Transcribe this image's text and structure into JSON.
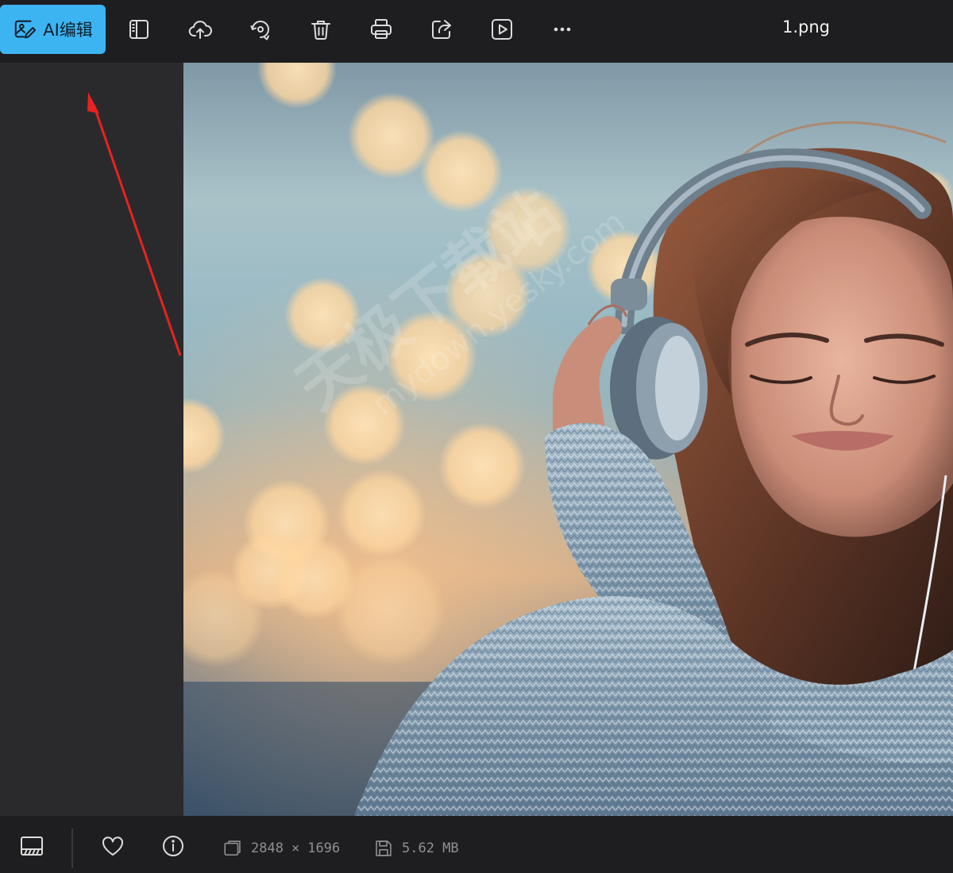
{
  "toolbar": {
    "ai_edit_label": "AI编辑",
    "tools": [
      {
        "name": "panel-toggle-icon"
      },
      {
        "name": "cloud-upload-icon"
      },
      {
        "name": "rotate-icon"
      },
      {
        "name": "trash-icon"
      },
      {
        "name": "print-icon"
      },
      {
        "name": "share-icon"
      },
      {
        "name": "slideshow-play-icon"
      },
      {
        "name": "more-icon"
      }
    ],
    "file_name": "1.png"
  },
  "image": {
    "watermark_text": "天极下载站",
    "watermark_url": "mydown.yesky.com"
  },
  "statusbar": {
    "width": "2848",
    "times": "×",
    "height": "1696",
    "file_size": "5.62 MB"
  },
  "colors": {
    "accent": "#3db4f2",
    "arrow": "#e8221e"
  }
}
